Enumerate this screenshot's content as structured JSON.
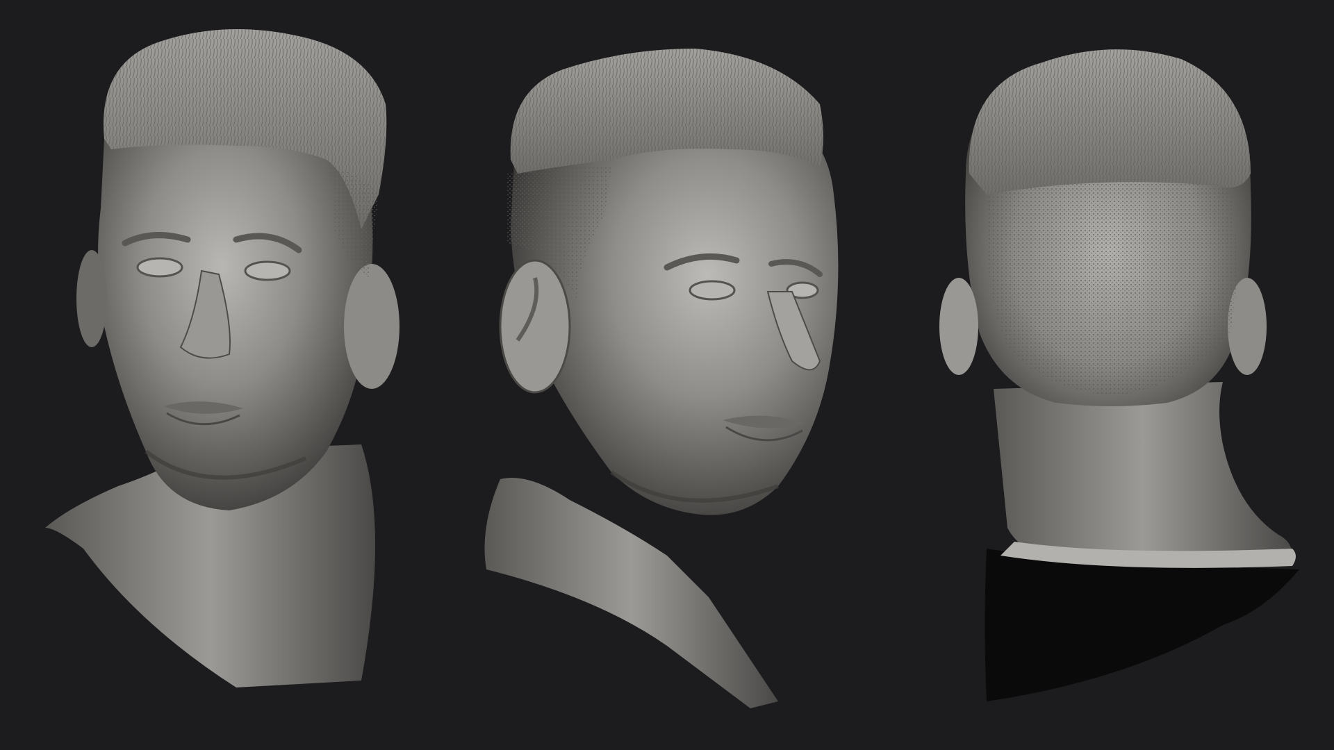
{
  "scene": {
    "background": "#1c1c1e",
    "clay_light": "#a8a6a2",
    "clay_mid": "#7e7c78",
    "clay_dark": "#3a3937",
    "views": [
      {
        "name": "front-three-quarter-view"
      },
      {
        "name": "side-three-quarter-view"
      },
      {
        "name": "back-view"
      }
    ]
  }
}
